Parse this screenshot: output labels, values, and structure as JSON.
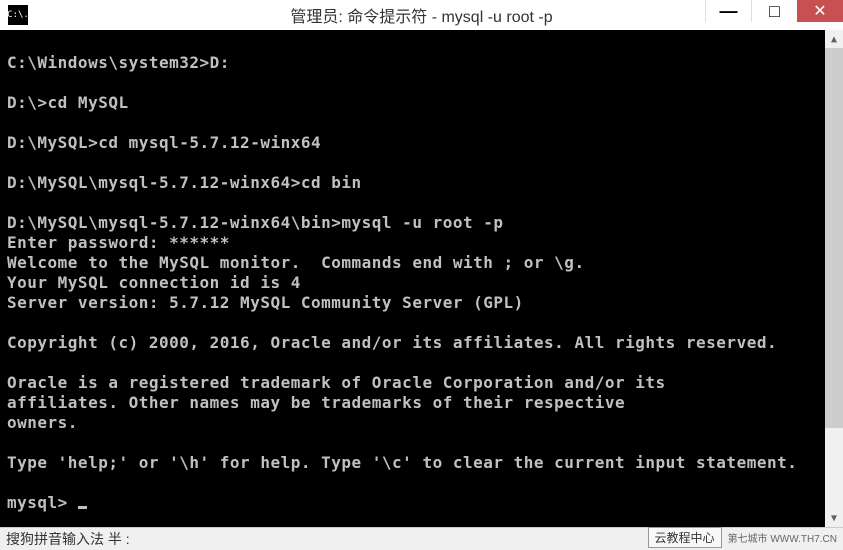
{
  "window": {
    "icon_text": "C:\\.",
    "title": "管理员: 命令提示符 - mysql  -u root -p",
    "controls": {
      "minimize": "—",
      "maximize": "□",
      "close": "✕"
    }
  },
  "terminal": {
    "lines": [
      "",
      "C:\\Windows\\system32>D:",
      "",
      "D:\\>cd MySQL",
      "",
      "D:\\MySQL>cd mysql-5.7.12-winx64",
      "",
      "D:\\MySQL\\mysql-5.7.12-winx64>cd bin",
      "",
      "D:\\MySQL\\mysql-5.7.12-winx64\\bin>mysql -u root -p",
      "Enter password: ******",
      "Welcome to the MySQL monitor.  Commands end with ; or \\g.",
      "Your MySQL connection id is 4",
      "Server version: 5.7.12 MySQL Community Server (GPL)",
      "",
      "Copyright (c) 2000, 2016, Oracle and/or its affiliates. All rights reserved.",
      "",
      "Oracle is a registered trademark of Oracle Corporation and/or its",
      "affiliates. Other names may be trademarks of their respective",
      "owners.",
      "",
      "Type 'help;' or '\\h' for help. Type '\\c' to clear the current input statement.",
      ""
    ],
    "prompt": "mysql> "
  },
  "ime": {
    "label": "搜狗拼音输入法 半 :",
    "badge": "云教程中心",
    "watermark": "第七城市   WWW.TH7.CN"
  }
}
